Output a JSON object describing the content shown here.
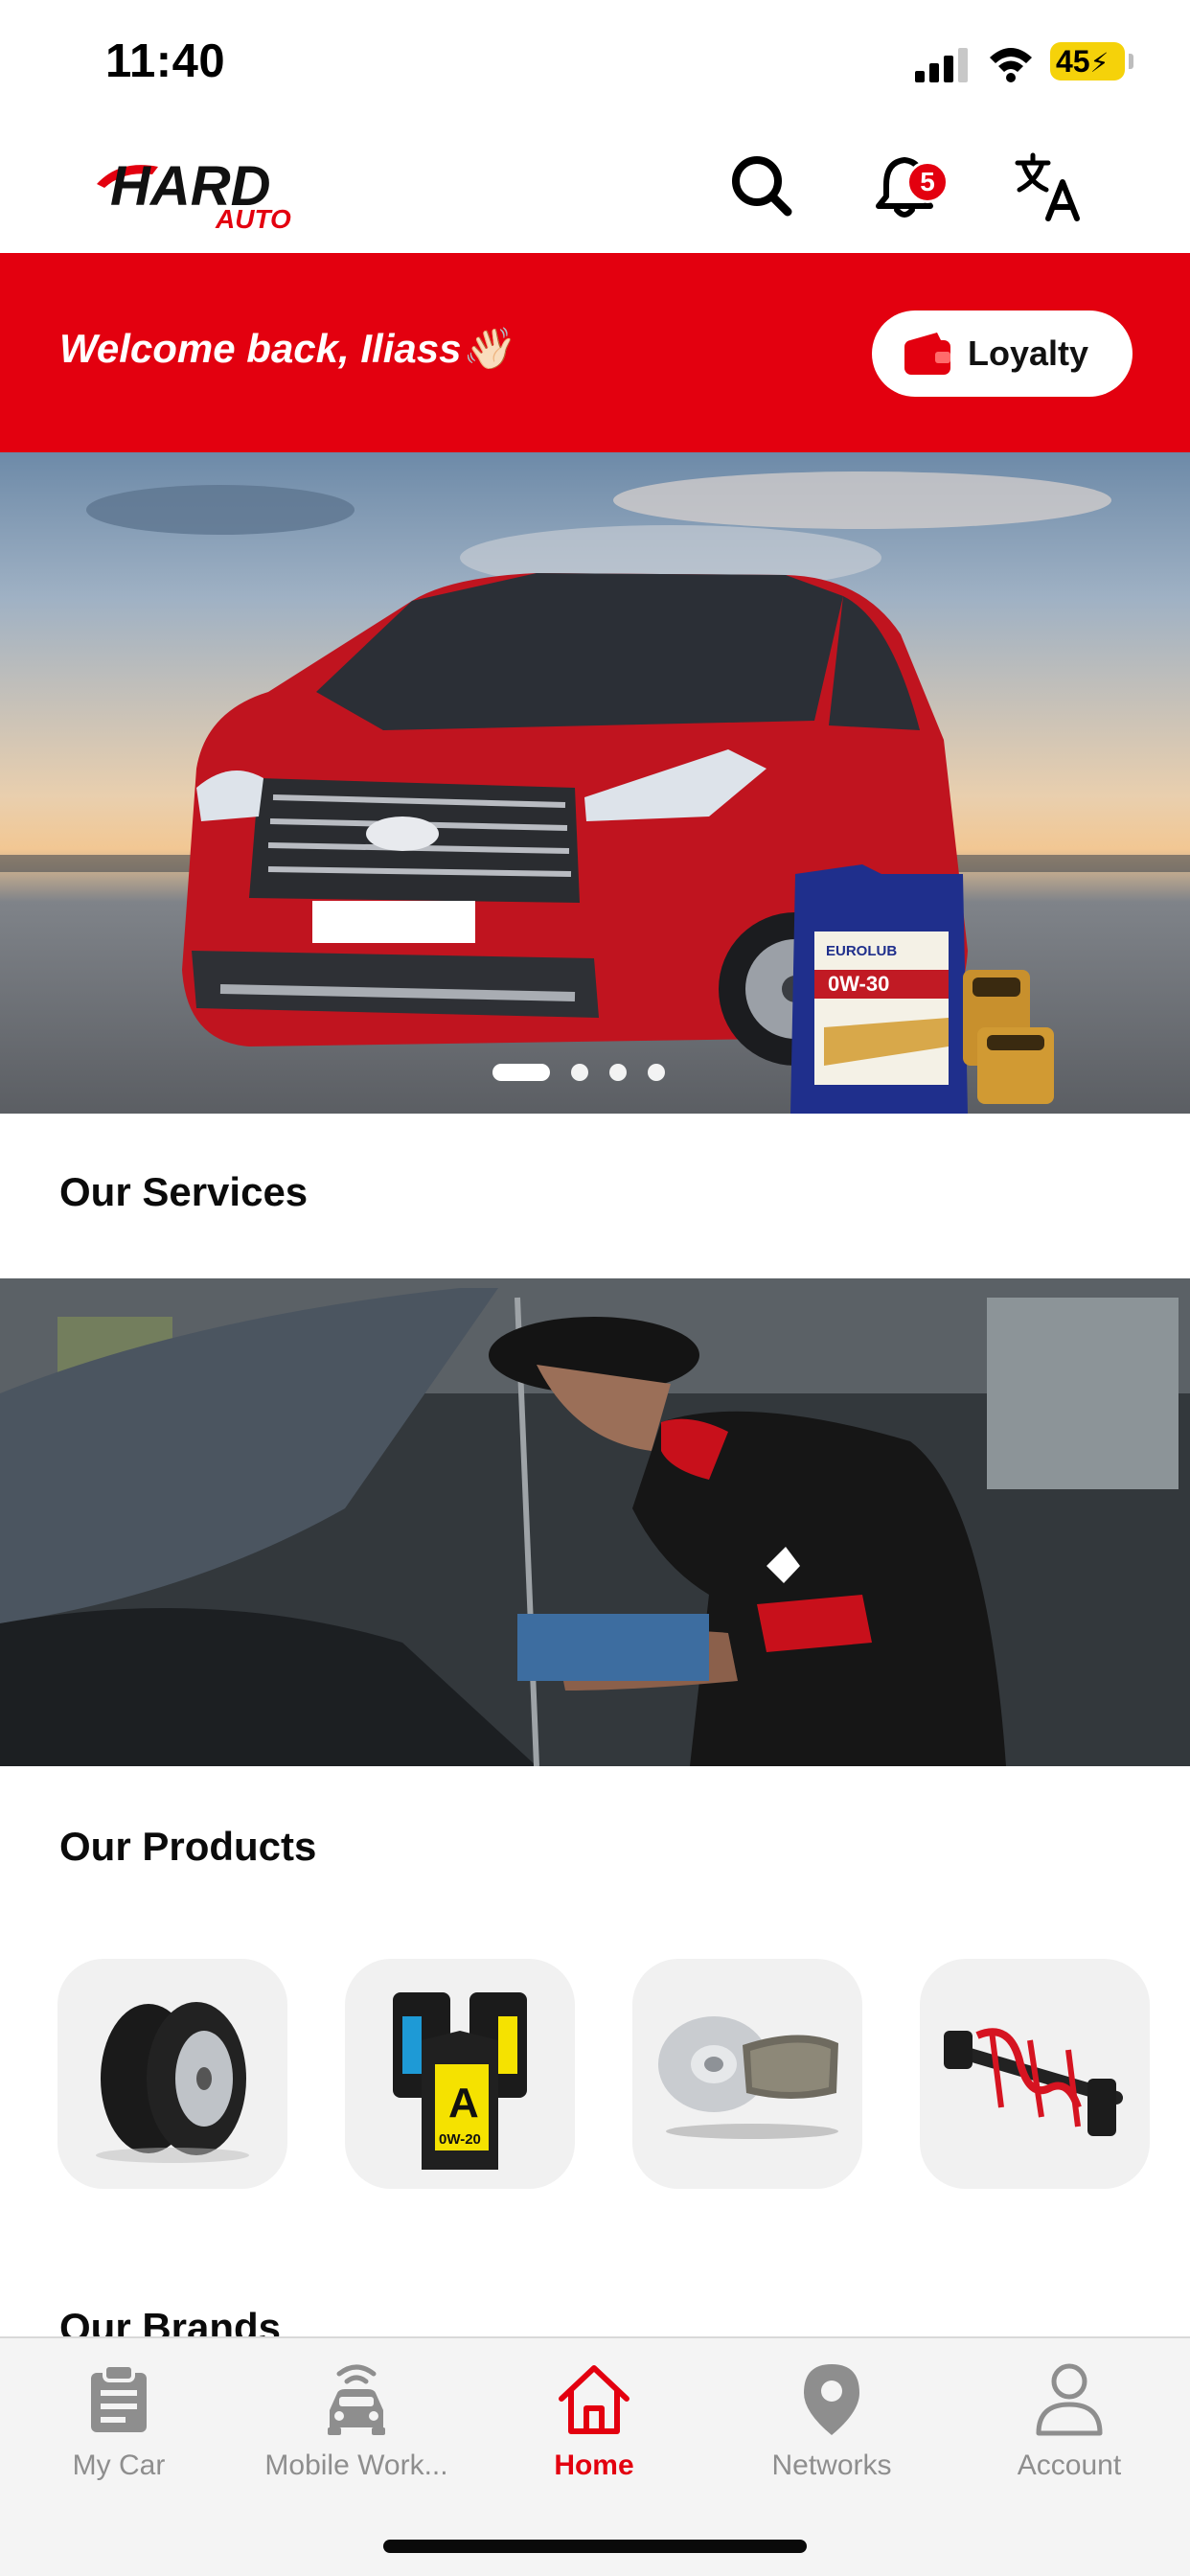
{
  "status_bar": {
    "time": "11:40",
    "battery": "45"
  },
  "header": {
    "logo_text": "HARD",
    "logo_subtext": "AUTO",
    "notification_count": "5",
    "icons": [
      "search-icon",
      "bell-icon",
      "translate-icon"
    ]
  },
  "welcome": {
    "text": "Welcome back, Iliass👋🏻",
    "loyalty_label": "Loyalty"
  },
  "hero": {
    "oil_brand": "EUROLUB",
    "oil_grade": "0W-30",
    "slides": 4,
    "active_slide": 1
  },
  "sections": {
    "services_title": "Our Services",
    "products_title": "Our Products",
    "brands_title": "Our Brands"
  },
  "products": [
    {
      "name": "tires",
      "icon": "tires-icon"
    },
    {
      "name": "oil",
      "icon": "oil-icon",
      "label": "A",
      "grade": "0W-20"
    },
    {
      "name": "brakes",
      "icon": "brakes-icon"
    },
    {
      "name": "suspension",
      "icon": "suspension-icon"
    }
  ],
  "tabbar": {
    "items": [
      {
        "label": "My Car",
        "icon": "clipboard-icon",
        "active": false
      },
      {
        "label": "Mobile Work...",
        "icon": "car-signal-icon",
        "active": false
      },
      {
        "label": "Home",
        "icon": "home-icon",
        "active": true
      },
      {
        "label": "Networks",
        "icon": "location-pin-icon",
        "active": false
      },
      {
        "label": "Account",
        "icon": "user-icon",
        "active": false
      }
    ]
  },
  "colors": {
    "brand_red": "#e3000f",
    "tab_inactive": "#8e8e8e",
    "tabbar_bg": "#f4f4f4"
  }
}
